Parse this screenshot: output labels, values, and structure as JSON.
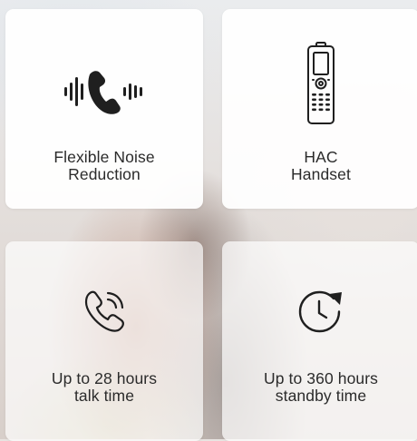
{
  "features": [
    {
      "icon": "noise-reduction-phone-icon",
      "line1": "Flexible Noise",
      "line2": "Reduction"
    },
    {
      "icon": "handset-icon",
      "line1": "HAC",
      "line2": "Handset"
    },
    {
      "icon": "phone-call-icon",
      "line1": "Up to 28 hours",
      "line2": "talk time"
    },
    {
      "icon": "clock-refresh-icon",
      "line1": "Up to 360 hours",
      "line2": "standby time"
    }
  ],
  "colors": {
    "icon": "#1f1f1f",
    "text": "#2b2b2b",
    "card": "#ffffff"
  }
}
